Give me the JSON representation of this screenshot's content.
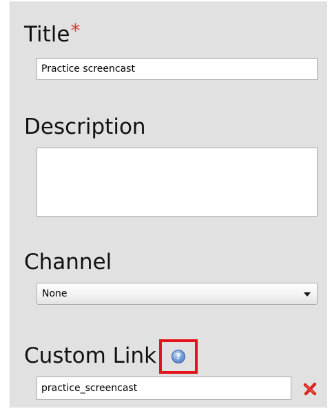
{
  "form": {
    "title": {
      "label": "Title",
      "required_mark": "*",
      "value": "Practice screencast"
    },
    "description": {
      "label": "Description",
      "value": ""
    },
    "channel": {
      "label": "Channel",
      "selected": "None"
    },
    "custom_link": {
      "label": "Custom Link",
      "help_icon": "question-icon",
      "help_glyph": "?",
      "value": "practice_screencast",
      "remove_icon": "red-x-icon"
    }
  },
  "colors": {
    "panel_bg": "#e1e1e1",
    "required": "#e33b2e",
    "highlight_box": "#e3121b",
    "remove_x": "#d7261e",
    "help_icon": "#5a86cc"
  }
}
